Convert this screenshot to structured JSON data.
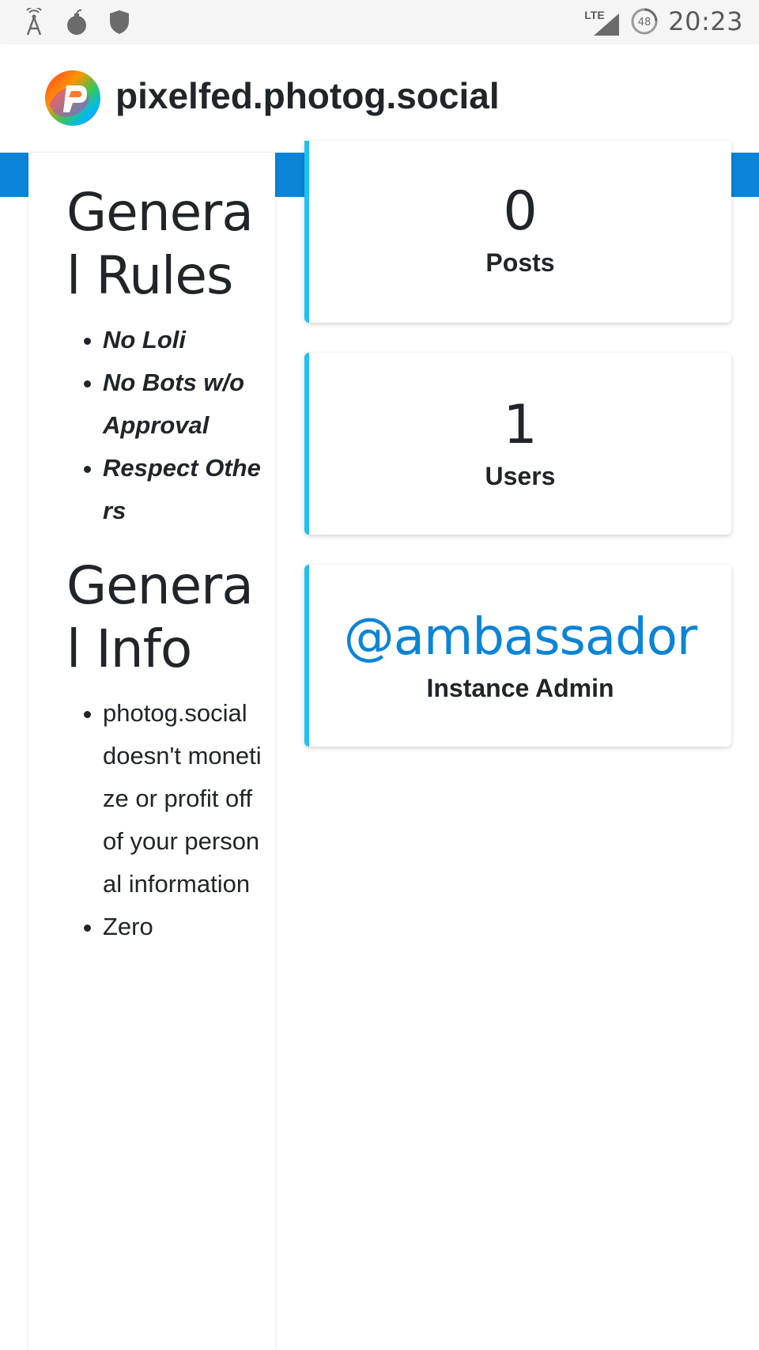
{
  "status_bar": {
    "left_icons": [
      "signal-tower-icon",
      "bomb-icon",
      "shield-icon"
    ],
    "network_label": "LTE",
    "battery_level": "48",
    "time": "20:23"
  },
  "header": {
    "site_title": "pixelfed.photog.social",
    "logo_icon": "pixelfed-logo-icon"
  },
  "colors": {
    "accent_blue": "#0a84d6",
    "card_border": "#1ec1f0",
    "text_dark": "#212529"
  },
  "rules_panel": {
    "rules_heading": "General Rules",
    "rules": [
      "No Loli",
      "No Bots w/o Approval",
      "Respect Others"
    ],
    "info_heading": "General Info",
    "info_items": [
      "photog.social doesn't monetize or profit off of your personal information",
      "Zero"
    ]
  },
  "stats": {
    "posts": {
      "value": "0",
      "label": "Posts"
    },
    "users": {
      "value": "1",
      "label": "Users"
    },
    "admin": {
      "handle": "@ambassador",
      "label": "Instance Admin"
    }
  }
}
